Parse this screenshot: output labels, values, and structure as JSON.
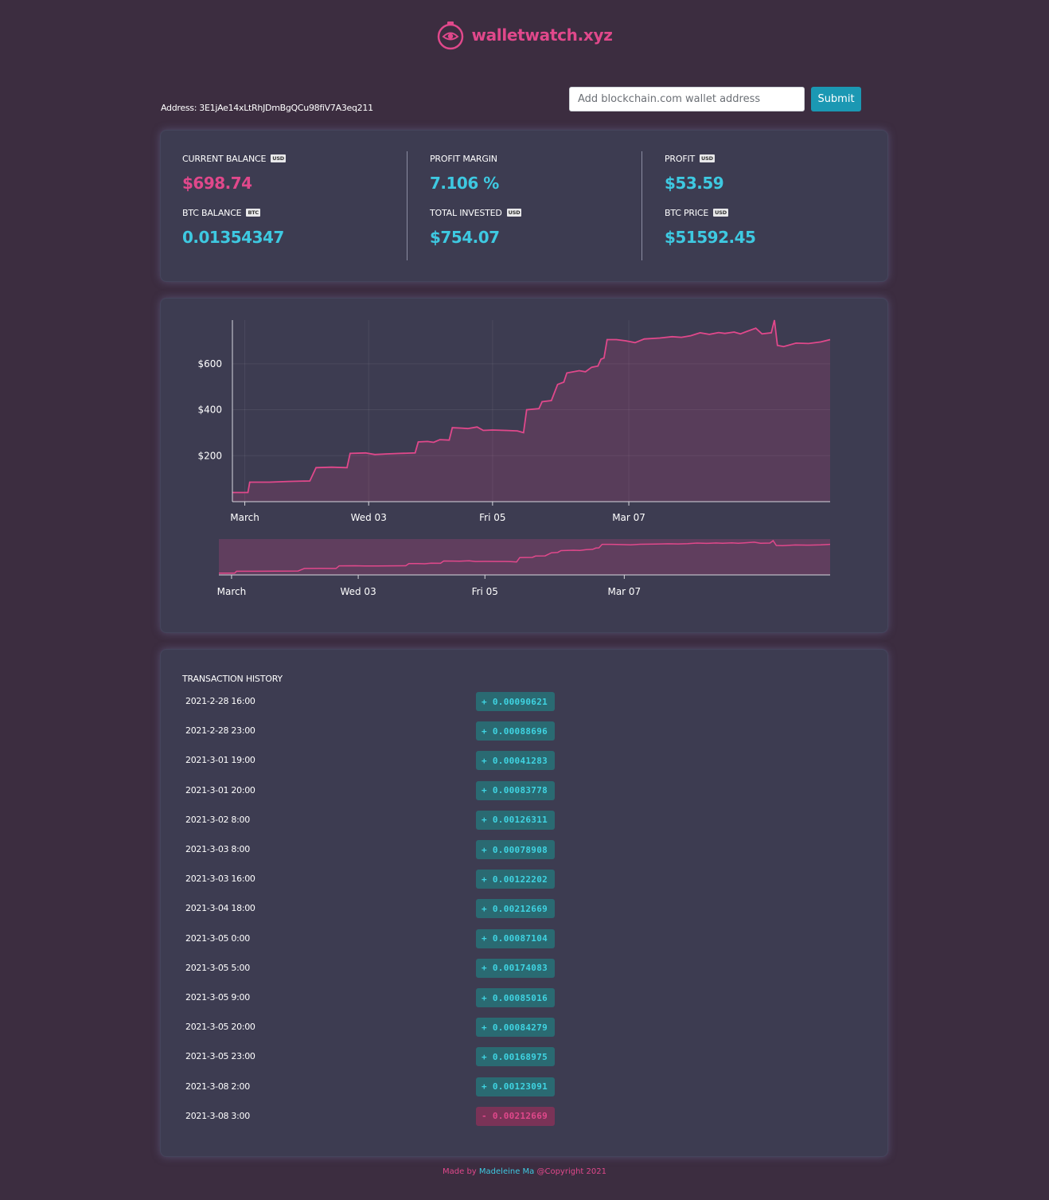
{
  "brand": {
    "name": "walletwatch.xyz",
    "color": "#e0488b"
  },
  "address": {
    "text": "Address: 3E1jAe14xLtRhJDmBgQCu98fiV7A3eq211"
  },
  "search": {
    "placeholder": "Add blockchain.com wallet address",
    "submit_label": "Submit"
  },
  "stats": {
    "current_balance": {
      "label": "CURRENT BALANCE",
      "badge": "USD",
      "value": "$698.74"
    },
    "btc_balance": {
      "label": "BTC BALANCE",
      "badge": "BTC",
      "value": "0.01354347"
    },
    "profit_margin": {
      "label": "PROFIT MARGIN",
      "value": "7.106 %"
    },
    "total_invested": {
      "label": "TOTAL INVESTED",
      "badge": "USD",
      "value": "$754.07"
    },
    "profit": {
      "label": "PROFIT",
      "badge": "USD",
      "value": "$53.59"
    },
    "btc_price": {
      "label": "BTC PRICE",
      "badge": "USD",
      "value": "$51592.45"
    }
  },
  "colors": {
    "accent_pink": "#e0488b",
    "accent_cyan": "#3ec9e1",
    "background": "#3c2d40",
    "card": "#3d3c51"
  },
  "chart_data": {
    "type": "area",
    "x_ticks": [
      "March",
      "Wed 03",
      "Fri 05",
      "Mar 07"
    ],
    "y_ticks": [
      "$200",
      "$400",
      "$600"
    ],
    "ylim": [
      0,
      790
    ],
    "x_range_days": [
      -0.2,
      7.65
    ],
    "grid": true,
    "series": [
      {
        "values": [
          [
            -0.2,
            40
          ],
          [
            0.05,
            40
          ],
          [
            0.08,
            85
          ],
          [
            0.4,
            85
          ],
          [
            0.7,
            88
          ],
          [
            1.05,
            90
          ],
          [
            1.15,
            148
          ],
          [
            1.4,
            150
          ],
          [
            1.65,
            148
          ],
          [
            1.7,
            210
          ],
          [
            1.95,
            212
          ],
          [
            2.1,
            205
          ],
          [
            2.3,
            208
          ],
          [
            2.5,
            210
          ],
          [
            2.75,
            212
          ],
          [
            2.8,
            260
          ],
          [
            2.95,
            262
          ],
          [
            3.05,
            258
          ],
          [
            3.15,
            270
          ],
          [
            3.3,
            268
          ],
          [
            3.35,
            322
          ],
          [
            3.5,
            320
          ],
          [
            3.6,
            318
          ],
          [
            3.75,
            325
          ],
          [
            3.85,
            310
          ],
          [
            4.0,
            312
          ],
          [
            4.2,
            310
          ],
          [
            4.4,
            308
          ],
          [
            4.5,
            300
          ],
          [
            4.55,
            400
          ],
          [
            4.75,
            405
          ],
          [
            4.8,
            435
          ],
          [
            4.95,
            440
          ],
          [
            5.05,
            510
          ],
          [
            5.15,
            520
          ],
          [
            5.2,
            560
          ],
          [
            5.4,
            570
          ],
          [
            5.5,
            565
          ],
          [
            5.6,
            585
          ],
          [
            5.7,
            590
          ],
          [
            5.75,
            620
          ],
          [
            5.8,
            625
          ],
          [
            5.85,
            705
          ],
          [
            6.0,
            705
          ],
          [
            6.15,
            700
          ],
          [
            6.3,
            692
          ],
          [
            6.45,
            708
          ],
          [
            6.7,
            712
          ],
          [
            6.9,
            718
          ],
          [
            7.05,
            715
          ],
          [
            7.2,
            722
          ],
          [
            7.35,
            735
          ],
          [
            7.5,
            728
          ],
          [
            7.65,
            736
          ],
          [
            7.75,
            732
          ],
          [
            7.9,
            738
          ],
          [
            8.0,
            730
          ],
          [
            8.1,
            740
          ],
          [
            8.25,
            755
          ],
          [
            8.35,
            730
          ],
          [
            8.5,
            735
          ],
          [
            8.55,
            790
          ],
          [
            8.6,
            680
          ],
          [
            8.7,
            675
          ],
          [
            8.9,
            690
          ],
          [
            9.1,
            688
          ],
          [
            9.3,
            695
          ],
          [
            9.45,
            705
          ]
        ]
      }
    ]
  },
  "transactions": {
    "title": "TRANSACTION HISTORY",
    "rows": [
      {
        "date": "2021-2-28 16:00",
        "amount": "+ 0.00090621",
        "type": "pos"
      },
      {
        "date": "2021-2-28 23:00",
        "amount": "+ 0.00088696",
        "type": "pos"
      },
      {
        "date": "2021-3-01 19:00",
        "amount": "+ 0.00041283",
        "type": "pos"
      },
      {
        "date": "2021-3-01 20:00",
        "amount": "+ 0.00083778",
        "type": "pos"
      },
      {
        "date": "2021-3-02 8:00",
        "amount": "+ 0.00126311",
        "type": "pos"
      },
      {
        "date": "2021-3-03 8:00",
        "amount": "+ 0.00078908",
        "type": "pos"
      },
      {
        "date": "2021-3-03 16:00",
        "amount": "+ 0.00122202",
        "type": "pos"
      },
      {
        "date": "2021-3-04 18:00",
        "amount": "+ 0.00212669",
        "type": "pos"
      },
      {
        "date": "2021-3-05 0:00",
        "amount": "+ 0.00087104",
        "type": "pos"
      },
      {
        "date": "2021-3-05 5:00",
        "amount": "+ 0.00174083",
        "type": "pos"
      },
      {
        "date": "2021-3-05 9:00",
        "amount": "+ 0.00085016",
        "type": "pos"
      },
      {
        "date": "2021-3-05 20:00",
        "amount": "+ 0.00084279",
        "type": "pos"
      },
      {
        "date": "2021-3-05 23:00",
        "amount": "+ 0.00168975",
        "type": "pos"
      },
      {
        "date": "2021-3-08 2:00",
        "amount": "+ 0.00123091",
        "type": "pos"
      },
      {
        "date": "2021-3-08 3:00",
        "amount": "- 0.00212669",
        "type": "neg"
      }
    ]
  },
  "footer": {
    "made_by": "Made by ",
    "author": "Madeleine Ma",
    "copyright": " @Copyright 2021"
  }
}
